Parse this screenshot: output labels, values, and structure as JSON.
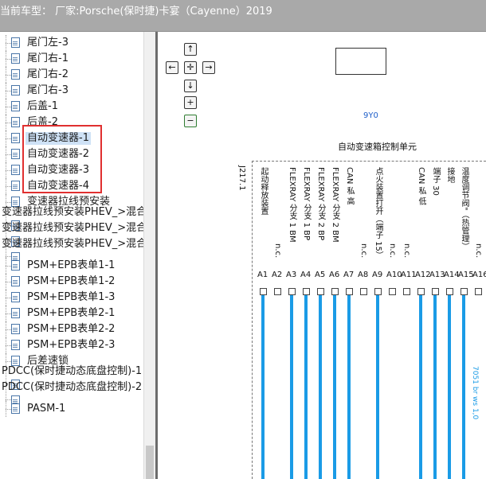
{
  "header": {
    "title": "当前车型：  厂家:Porsche(保时捷)卡宴（Cayenne）2019"
  },
  "tree": {
    "items": [
      {
        "label": "尾门左-3",
        "depth": 1
      },
      {
        "label": "尾门右-1",
        "depth": 1
      },
      {
        "label": "尾门右-2",
        "depth": 1
      },
      {
        "label": "尾门右-3",
        "depth": 1
      },
      {
        "label": "后盖-1",
        "depth": 1
      },
      {
        "label": "后盖-2",
        "depth": 1
      },
      {
        "label": "自动变速器-1",
        "depth": 1,
        "selected": true
      },
      {
        "label": "自动变速器-2",
        "depth": 1
      },
      {
        "label": "自动变速器-3",
        "depth": 1
      },
      {
        "label": "自动变速器-4",
        "depth": 1
      },
      {
        "label": "变速器拉线预安装",
        "depth": 1
      },
      {
        "label": "变速器拉线预安装PHEV_>混合",
        "depth": 0
      },
      {
        "label": "变速器拉线预安装PHEV_>混合",
        "depth": 0
      },
      {
        "label": "变速器拉线预安装PHEV_>混合",
        "depth": 0
      },
      {
        "label": "PSM+EPB表单1-1",
        "depth": 1
      },
      {
        "label": "PSM+EPB表单1-2",
        "depth": 1
      },
      {
        "label": "PSM+EPB表单1-3",
        "depth": 1
      },
      {
        "label": "PSM+EPB表单2-1",
        "depth": 1
      },
      {
        "label": "PSM+EPB表单2-2",
        "depth": 1
      },
      {
        "label": "PSM+EPB表单2-3",
        "depth": 1
      },
      {
        "label": "后差速锁",
        "depth": 1
      },
      {
        "label": "PDCC(保时捷动态底盘控制)-1",
        "depth": 0
      },
      {
        "label": "PDCC(保时捷动态底盘控制)-2",
        "depth": 0
      },
      {
        "label": "PASM-1",
        "depth": 1
      }
    ]
  },
  "nav": {
    "up": "↑",
    "left": "←",
    "center": "✛",
    "right": "→",
    "down": "↓",
    "zoom_in": "+",
    "zoom_out": "−"
  },
  "diagram": {
    "code": "9Y0",
    "unit_title": "自动变速箱控制单元",
    "ref": "J217.1",
    "colors": {
      "wire": "#1a9be6",
      "code": "#1f5fc9"
    },
    "pins": [
      {
        "pin": "A1",
        "label": "起动释放装置"
      },
      {
        "pin": "A2",
        "label": "n.c."
      },
      {
        "pin": "A3",
        "label": "FLEXRAY 分支 1 BM"
      },
      {
        "pin": "A4",
        "label": "FLEXRAY 分支 1 BP"
      },
      {
        "pin": "A5",
        "label": "FLEXRAY 分支 2 BP"
      },
      {
        "pin": "A6",
        "label": "FLEXRAY 分支 2 BM"
      },
      {
        "pin": "A7",
        "label": "CAN 私 高"
      },
      {
        "pin": "A8",
        "label": "n.c."
      },
      {
        "pin": "A9",
        "label": "点火装置打开（端子 15）"
      },
      {
        "pin": "A10",
        "label": "n.c."
      },
      {
        "pin": "A11",
        "label": "n.c."
      },
      {
        "pin": "A12",
        "label": "CAN 私 低"
      },
      {
        "pin": "A13",
        "label": "端子 30"
      },
      {
        "pin": "A14",
        "label": "接地"
      },
      {
        "pin": "A15",
        "label": "温度调节阀\"（热管理）"
      },
      {
        "pin": "A16",
        "label": "n.c."
      }
    ],
    "wire_labels": [
      "7051 br ws 1,0"
    ]
  }
}
